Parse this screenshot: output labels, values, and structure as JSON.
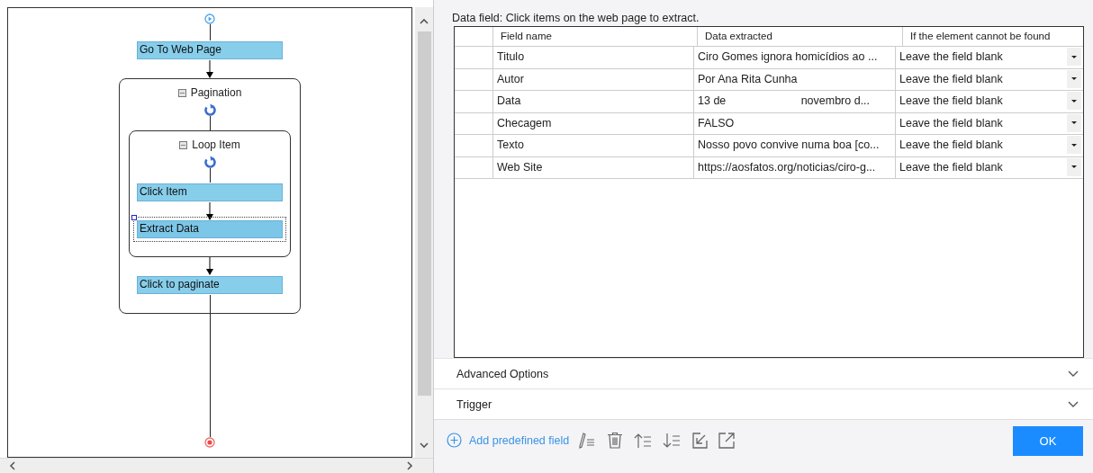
{
  "workflow": {
    "steps": [
      {
        "kind": "action",
        "label": "Go To Web Page",
        "selected": false
      },
      {
        "kind": "loop",
        "label": "Pagination",
        "expanded": true,
        "children": [
          {
            "kind": "loop",
            "label": "Loop Item",
            "expanded": true,
            "children": [
              {
                "kind": "action",
                "label": "Click Item",
                "selected": false
              },
              {
                "kind": "action",
                "label": "Extract Data",
                "selected": true
              }
            ]
          },
          {
            "kind": "action",
            "label": "Click to paginate",
            "selected": false
          }
        ]
      }
    ]
  },
  "panel": {
    "title": "Data field: Click items on the web page to extract.",
    "table": {
      "columns": [
        "Field name",
        "Data extracted",
        "If the element cannot be found"
      ],
      "rows": [
        {
          "field": "Titulo",
          "data": "Ciro Gomes ignora homicídios ao ...",
          "fallback": "Leave the field blank"
        },
        {
          "field": "Autor",
          "data": "Por Ana Rita Cunha",
          "fallback": "Leave the field blank"
        },
        {
          "field": "Data",
          "data": "13 de                        novembro d...",
          "fallback": "Leave the field blank"
        },
        {
          "field": "Checagem",
          "data": "FALSO",
          "fallback": "Leave the field blank"
        },
        {
          "field": "Texto",
          "data": "Nosso povo convive numa boa [co...",
          "fallback": "Leave the field blank"
        },
        {
          "field": "Web Site",
          "data": "https://aosfatos.org/noticias/ciro-g...",
          "fallback": "Leave the field blank"
        }
      ]
    },
    "sections": [
      {
        "label": "Advanced Options",
        "expanded": false
      },
      {
        "label": "Trigger",
        "expanded": false
      }
    ],
    "add_link": "Add predefined field",
    "ok_button": "OK"
  }
}
